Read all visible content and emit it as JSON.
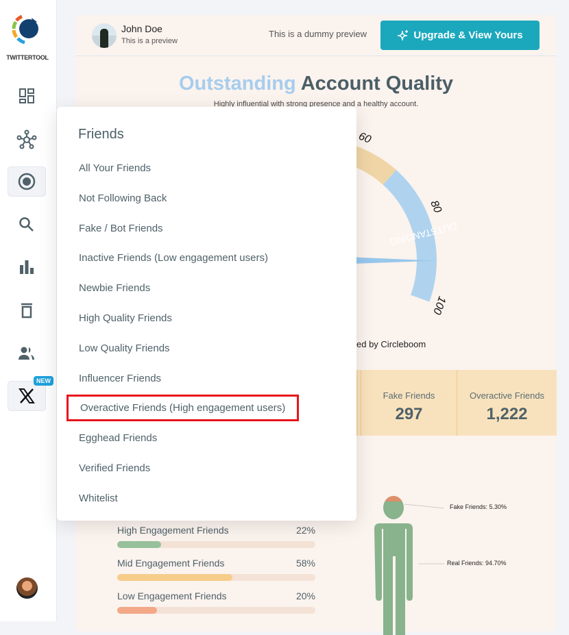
{
  "sidebar": {
    "logo_text": "TWITTERTOOL",
    "items": [
      {
        "icon": "dashboard-icon"
      },
      {
        "icon": "network-icon"
      },
      {
        "icon": "radio-target-icon",
        "active": true
      },
      {
        "icon": "search-icon"
      },
      {
        "icon": "bar-chart-icon"
      },
      {
        "icon": "trash-icon"
      },
      {
        "icon": "users-icon"
      },
      {
        "icon": "x-logo-icon",
        "badge": "NEW"
      }
    ]
  },
  "header": {
    "user_name": "John Doe",
    "user_sub": "This is a preview",
    "dummy_text": "This is a dummy preview",
    "upgrade_label": "Upgrade & View Yours"
  },
  "quality": {
    "title_highlight": "Outstanding",
    "title_rest": "Account Quality",
    "subtitle": "Highly influential with strong presence and a healthy account.",
    "gauge_value": 91,
    "gauge_ticks": [
      "60",
      "80",
      "100"
    ],
    "gauge_band_label": "OUTSTANDING",
    "credit": "ed by Circleboom"
  },
  "stats": [
    {
      "label": "Fake Friends",
      "value": "297"
    },
    {
      "label": "Overactive Friends",
      "value": "1,222"
    }
  ],
  "engagement": [
    {
      "label": "High Engagement Friends",
      "percent": "22%",
      "value": 22,
      "color": "#97c09b"
    },
    {
      "label": "Mid Engagement Friends",
      "percent": "58%",
      "value": 58,
      "color": "#f7cd8b"
    },
    {
      "label": "Low Engagement Friends",
      "percent": "20%",
      "value": 20,
      "color": "#f3a887"
    }
  ],
  "figure": {
    "fake_label": "Fake Friends: 5.30%",
    "real_label": "Real Friends: 94.70%",
    "fake_color": "#de8f6c",
    "real_color": "#88b38d"
  },
  "menu": {
    "title": "Friends",
    "items": [
      "All Your Friends",
      "Not Following Back",
      "Fake / Bot Friends",
      "Inactive Friends (Low engagement users)",
      "Newbie Friends",
      "High Quality Friends",
      "Low Quality Friends",
      "Influencer Friends",
      "Overactive Friends (High engagement users)",
      "Egghead Friends",
      "Verified Friends",
      "Whitelist"
    ],
    "highlighted_index": 8
  }
}
